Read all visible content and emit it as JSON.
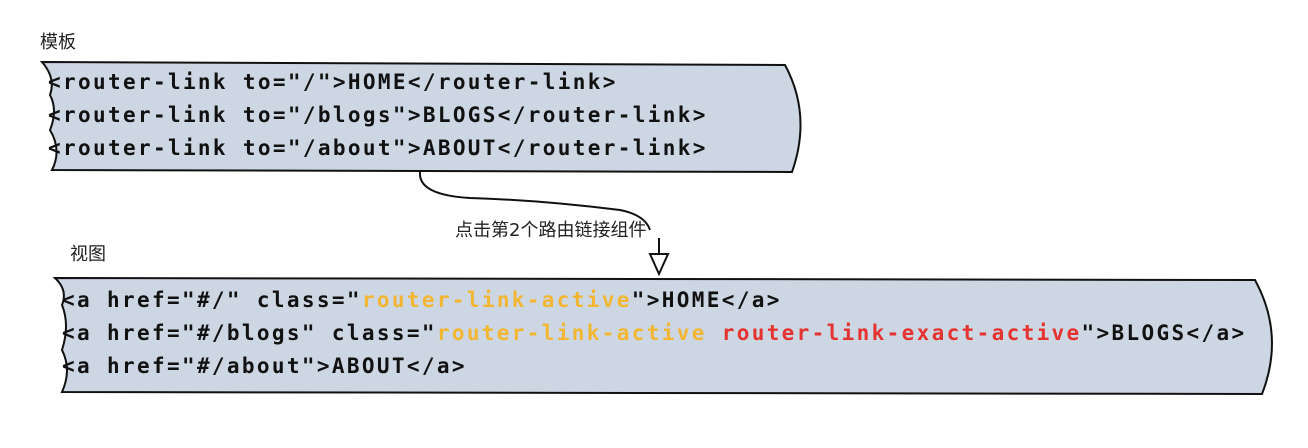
{
  "template_label": "模板",
  "view_label": "视图",
  "annotation": "点击第2个路由链接组件",
  "template_lines": [
    "<router-link to=\"/\">HOME</router-link>",
    "<router-link to=\"/blogs\">BLOGS</router-link>",
    "<router-link to=\"/about\">ABOUT</router-link>"
  ],
  "view_lines": [
    {
      "pre": "<a href=\"#/\" class=\"",
      "active": "router-link-active",
      "exact": "",
      "post": "\">HOME</a>"
    },
    {
      "pre": "<a href=\"#/blogs\" class=\"",
      "active": "router-link-active",
      "exact": " router-link-exact-active",
      "post": "\">BLOGS</a>"
    },
    {
      "pre": "<a href=\"#/about\">ABOUT</a>",
      "active": "",
      "exact": "",
      "post": ""
    }
  ],
  "colors": {
    "panel": "#cdd7e4",
    "active": "#f2b632",
    "exact_active": "#e5332f"
  }
}
